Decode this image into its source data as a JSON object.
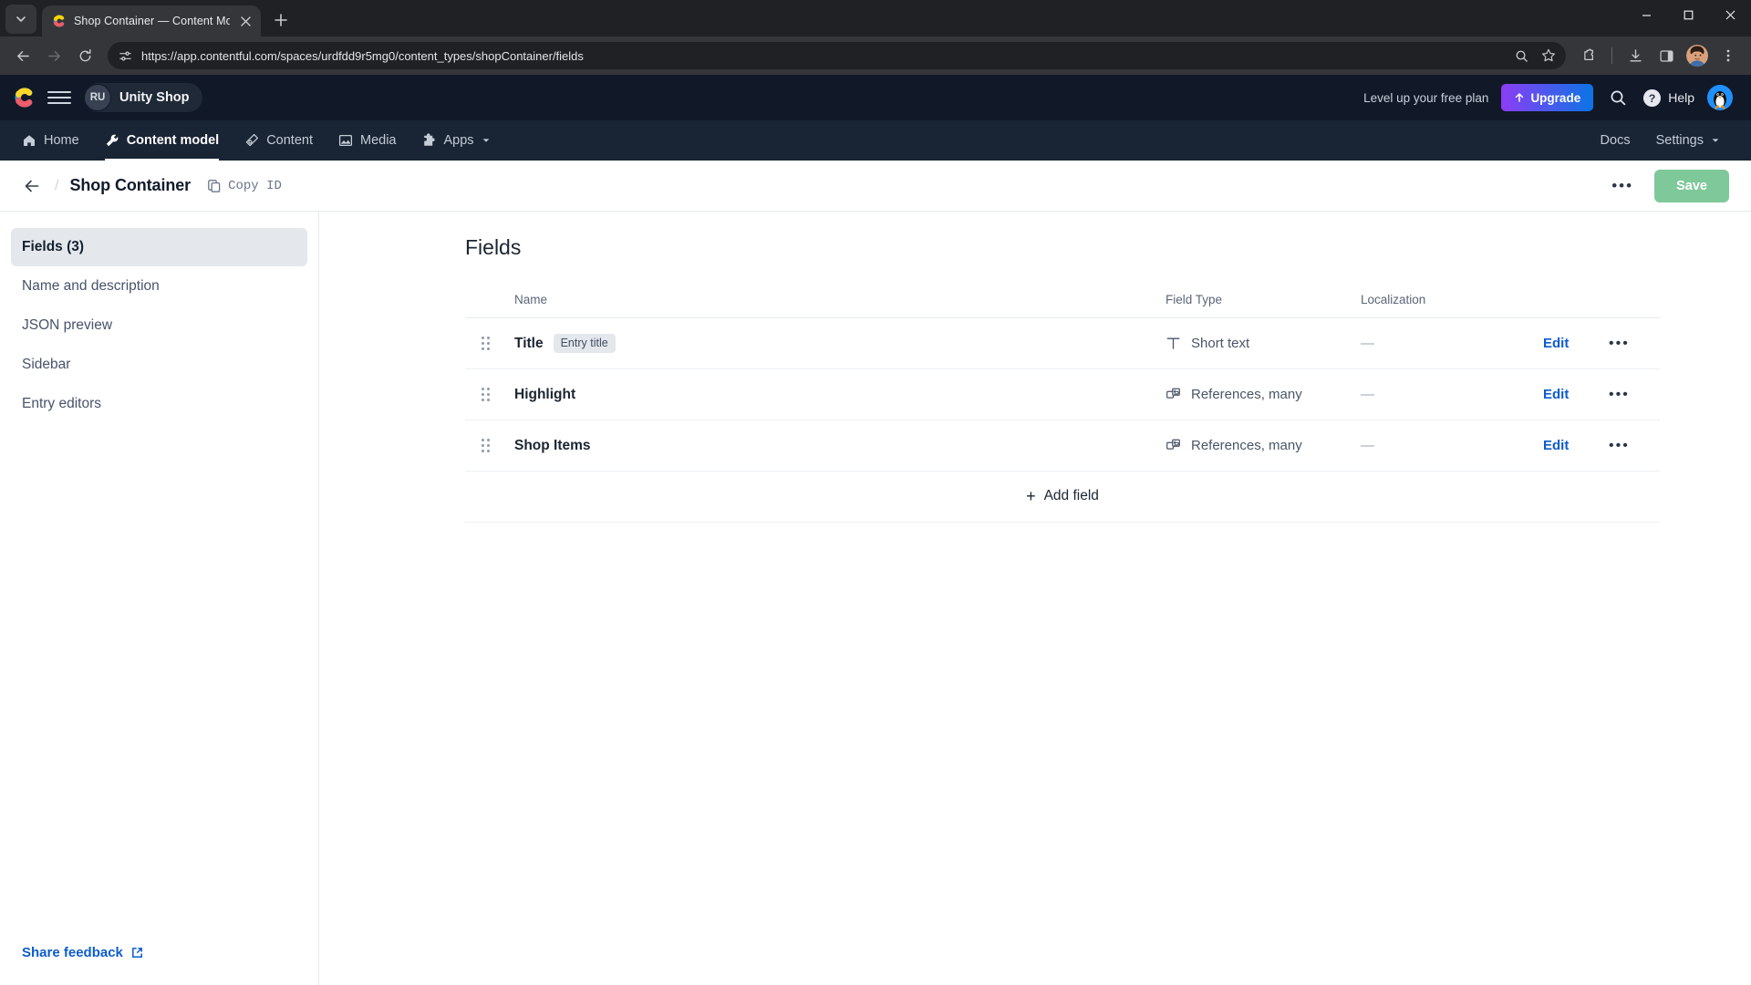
{
  "browser": {
    "tab": {
      "title": "Shop Container — Content Mo",
      "favicon": "contentful-favicon"
    },
    "new_tab_label": "+",
    "url": "https://app.contentful.com/spaces/urdfdd9r5mg0/content_types/shopContainer/fields",
    "icons": {
      "tab_list": "chevron-down-icon",
      "close_tab": "close-icon",
      "back": "back-arrow-icon",
      "forward": "forward-arrow-icon",
      "reload": "reload-icon",
      "site_info": "site-settings-icon",
      "zoom": "zoom-search-icon",
      "bookmark": "star-icon",
      "extensions": "extensions-puzzle-icon",
      "downloads": "download-icon",
      "side_panel": "side-panel-icon",
      "profile": "profile-avatar-icon",
      "menu": "three-dot-menu-icon",
      "minimize": "minimize-icon",
      "maximize": "maximize-icon",
      "close_window": "window-close-icon"
    }
  },
  "topbar": {
    "logo": "contentful-logo",
    "menu_icon": "hamburger-menu-icon",
    "space_initials": "RU",
    "space_name": "Unity Shop",
    "level_up_text": "Level up your free plan",
    "upgrade_label": "Upgrade",
    "upgrade_icon": "arrow-up-icon",
    "search_icon": "search-icon",
    "help_label": "Help",
    "help_icon": "question-mark-icon",
    "avatar": "user-avatar-penguin",
    "colors": {
      "background": "#111827",
      "upgrade_gradient_start": "#8b3df5",
      "upgrade_gradient_end": "#0b74e5"
    }
  },
  "nav": {
    "items": [
      {
        "label": "Home",
        "icon": "home-icon",
        "active": false
      },
      {
        "label": "Content model",
        "icon": "wrench-icon",
        "active": true
      },
      {
        "label": "Content",
        "icon": "pen-nib-icon",
        "active": false
      },
      {
        "label": "Media",
        "icon": "image-icon",
        "active": false
      },
      {
        "label": "Apps",
        "icon": "puzzle-icon",
        "active": false,
        "caret": "chevron-down-icon"
      }
    ],
    "right_items": [
      {
        "label": "Docs"
      },
      {
        "label": "Settings",
        "caret": "chevron-down-icon"
      }
    ]
  },
  "page_header": {
    "back_icon": "back-arrow-icon",
    "separator": "/",
    "title": "Shop Container",
    "copy_id_label": "Copy ID",
    "copy_icon": "copy-icon",
    "kebab": "•••",
    "save_label": "Save",
    "save_color": "#7fc89a"
  },
  "sidebar": {
    "items": [
      {
        "label": "Fields (3)",
        "active": true
      },
      {
        "label": "Name and description",
        "active": false
      },
      {
        "label": "JSON preview",
        "active": false
      },
      {
        "label": "Sidebar",
        "active": false
      },
      {
        "label": "Entry editors",
        "active": false
      }
    ],
    "share_feedback_label": "Share feedback",
    "share_feedback_icon": "external-link-icon"
  },
  "main": {
    "heading": "Fields",
    "columns": {
      "name": "Name",
      "field_type": "Field Type",
      "localization": "Localization"
    },
    "rows": [
      {
        "name": "Title",
        "badge": "Entry title",
        "type": "Short text",
        "type_icon": "short-text-icon",
        "localization": "—",
        "edit_label": "Edit",
        "kebab": "•••"
      },
      {
        "name": "Highlight",
        "badge": "",
        "type": "References, many",
        "type_icon": "reference-icon",
        "localization": "—",
        "edit_label": "Edit",
        "kebab": "•••"
      },
      {
        "name": "Shop Items",
        "badge": "",
        "type": "References, many",
        "type_icon": "reference-icon",
        "localization": "—",
        "edit_label": "Edit",
        "kebab": "•••"
      }
    ],
    "add_field_label": "Add field",
    "add_field_icon": "plus-icon",
    "link_color": "#0d5ccd"
  }
}
